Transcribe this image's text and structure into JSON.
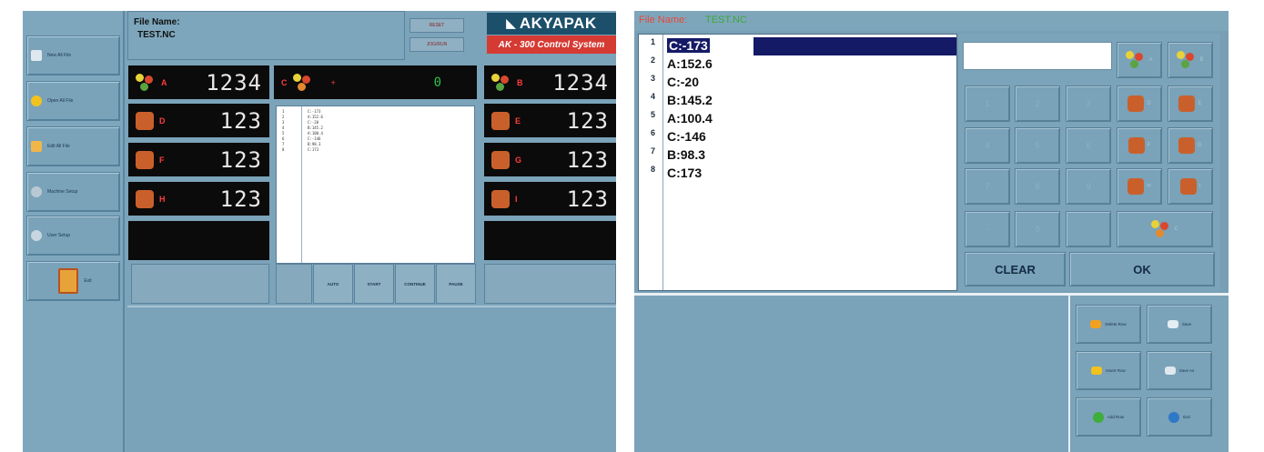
{
  "left_screen": {
    "sidebar": {
      "items": [
        {
          "label": "New All File",
          "icon": "new-file-icon"
        },
        {
          "label": "Open All File",
          "icon": "open-file-icon"
        },
        {
          "label": "Edit All File",
          "icon": "edit-file-icon"
        },
        {
          "label": "Machine Setup",
          "icon": "machine-setup-icon"
        },
        {
          "label": "User Setup",
          "icon": "user-setup-icon"
        },
        {
          "label": "Exit",
          "icon": "exit-door-icon"
        }
      ]
    },
    "file_header": {
      "label": "File Name:",
      "value": "TEST.NC"
    },
    "top_buttons": {
      "reset": "RESET",
      "jog_mode": "JOG/RUN"
    },
    "brand": {
      "name": "AKYAPAK",
      "model": "AK - 300 Control System"
    },
    "axes": {
      "A": {
        "letter": "A",
        "value": "1234"
      },
      "B": {
        "letter": "B",
        "value": "1234"
      },
      "C": {
        "letter": "C",
        "value": "0",
        "sign": "+"
      },
      "D": {
        "letter": "D",
        "value": "123"
      },
      "E": {
        "letter": "E",
        "value": "123"
      },
      "F": {
        "letter": "F",
        "value": "123"
      },
      "G": {
        "letter": "G",
        "value": "123"
      },
      "H": {
        "letter": "H",
        "value": "123"
      },
      "I": {
        "letter": "I",
        "value": "123"
      }
    },
    "program_lines": [
      "C:-173",
      "A:152.6",
      "C:-20",
      "B:145.2",
      "A:100.4",
      "C:-146",
      "B:98.3",
      "C:173"
    ],
    "run_buttons": [
      "AUTO",
      "START",
      "CONTINUE",
      "PAUSE"
    ]
  },
  "right_screen": {
    "title": {
      "label": "File Name:",
      "value": "TEST.NC"
    },
    "code_lines": [
      {
        "n": "1",
        "text": "C:-173"
      },
      {
        "n": "2",
        "text": "A:152.6"
      },
      {
        "n": "3",
        "text": "C:-20"
      },
      {
        "n": "4",
        "text": "B:145.2"
      },
      {
        "n": "5",
        "text": "A:100.4"
      },
      {
        "n": "6",
        "text": "C:-146"
      },
      {
        "n": "7",
        "text": "B:98.3"
      },
      {
        "n": "8",
        "text": "C:173"
      }
    ],
    "keypad": {
      "digits": [
        "1",
        "2",
        "3",
        "4",
        "5",
        "6",
        "7",
        "8",
        "9",
        "-",
        "0",
        "."
      ],
      "axis_keys": [
        "A",
        "B",
        "D",
        "E",
        "F",
        "G",
        "H",
        "I",
        "C"
      ],
      "clear_label": "CLEAR",
      "ok_label": "OK"
    },
    "actions": [
      {
        "label": "Delete Row",
        "icon": "delete-row-icon"
      },
      {
        "label": "Save",
        "icon": "save-icon"
      },
      {
        "label": "Insert Row",
        "icon": "insert-row-icon"
      },
      {
        "label": "Save As",
        "icon": "save-as-icon"
      },
      {
        "label": "Add Row",
        "icon": "add-row-icon"
      },
      {
        "label": "Exit",
        "icon": "exit-icon"
      }
    ]
  },
  "colors": {
    "panel_blue": "#78a1b8",
    "display_black": "#0b0b0b",
    "axis_letter_red": "#ff3b3b",
    "selection_navy": "#141a66",
    "brand_navy": "#1c4f6a",
    "brand_red": "#d53a33"
  }
}
